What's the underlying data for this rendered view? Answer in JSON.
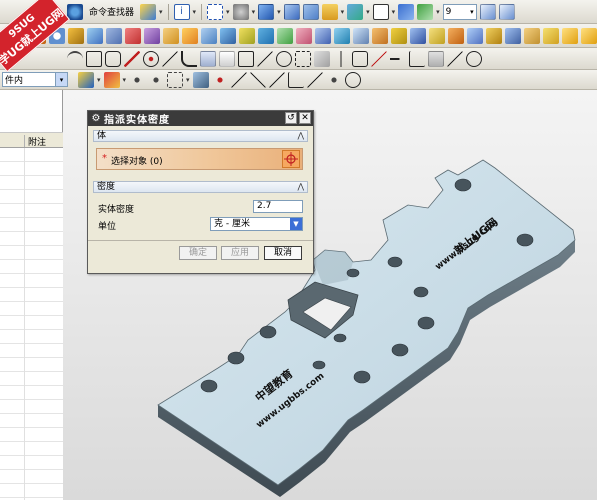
{
  "logo": {
    "line1": "学UG就上UG网",
    "line2": "9SUG"
  },
  "toolbar1": {
    "command_finder_label": "命令查找器",
    "layer_value": "9",
    "icons": [
      "snap-icon",
      "cube-blue-icon",
      "wire-icon",
      "render-icon",
      "folder-icon",
      "cube-shaded-icon",
      "grid-icon",
      "arrow-icon",
      "palette-icon",
      "square-view-icon",
      "dropdown-icon",
      "layer-icon"
    ]
  },
  "toolbar2": {
    "icons": [
      "book-icon",
      "hole-icon",
      "sketch-icon",
      "extrude-icon",
      "revolve-icon",
      "blend-icon",
      "sweep-icon",
      "chamfer-icon",
      "shell-icon",
      "mirror-icon",
      "pattern-icon",
      "trim-icon",
      "sew-icon",
      "feature-icon",
      "surface-icon",
      "offset-icon",
      "thicken-icon",
      "datum-icon",
      "cylinder-icon",
      "block-icon",
      "cone-icon",
      "sphere-icon",
      "tube-icon",
      "boolean-icon",
      "unite-icon",
      "subtract-icon",
      "intersect-icon",
      "draft-icon",
      "edge-icon",
      "face-icon"
    ]
  },
  "toolbar3": {
    "icons": [
      "line-icon",
      "arc-icon",
      "rect-icon",
      "polygon-icon",
      "spline-icon",
      "point-icon",
      "fillet-icon",
      "dimension-icon",
      "constraint-icon",
      "text-icon",
      "measure-icon",
      "analysis-icon",
      "offset-curve-icon",
      "project-icon",
      "mirror-curve-icon",
      "pattern-curve-icon",
      "trim-curve-icon",
      "extend-icon",
      "corner-icon",
      "quick-trim-icon",
      "derived-icon",
      "intersect-curve-icon"
    ]
  },
  "toolbar4": {
    "filter_value": "件内",
    "icons": [
      "select-icon",
      "snap-point-icon",
      "end-point-icon",
      "mid-point-icon",
      "control-point-icon",
      "intersection-icon",
      "center-icon",
      "quadrant-icon",
      "existing-point-icon",
      "on-curve-icon",
      "on-face-icon",
      "bounding-icon",
      "pole-icon"
    ]
  },
  "navigator": {
    "col_note": "附注",
    "rows": 26
  },
  "dialog": {
    "title": "指派实体密度",
    "section_body": "体",
    "select_label": "选择对象 (0)",
    "section_density": "密度",
    "density_label": "实体密度",
    "density_value": "2.7",
    "unit_label": "单位",
    "unit_value": "克 - 厘米",
    "ok_label": "确定",
    "apply_label": "应用",
    "cancel_label": "取消"
  },
  "model": {
    "text_left_1": "中望教育",
    "text_left_2": "www.ugbbs.com",
    "text_right_1": "就上UG网",
    "text_right_2": "www.9sug.com",
    "face_color": "#c9dce6",
    "side_color": "#5b6b75"
  }
}
